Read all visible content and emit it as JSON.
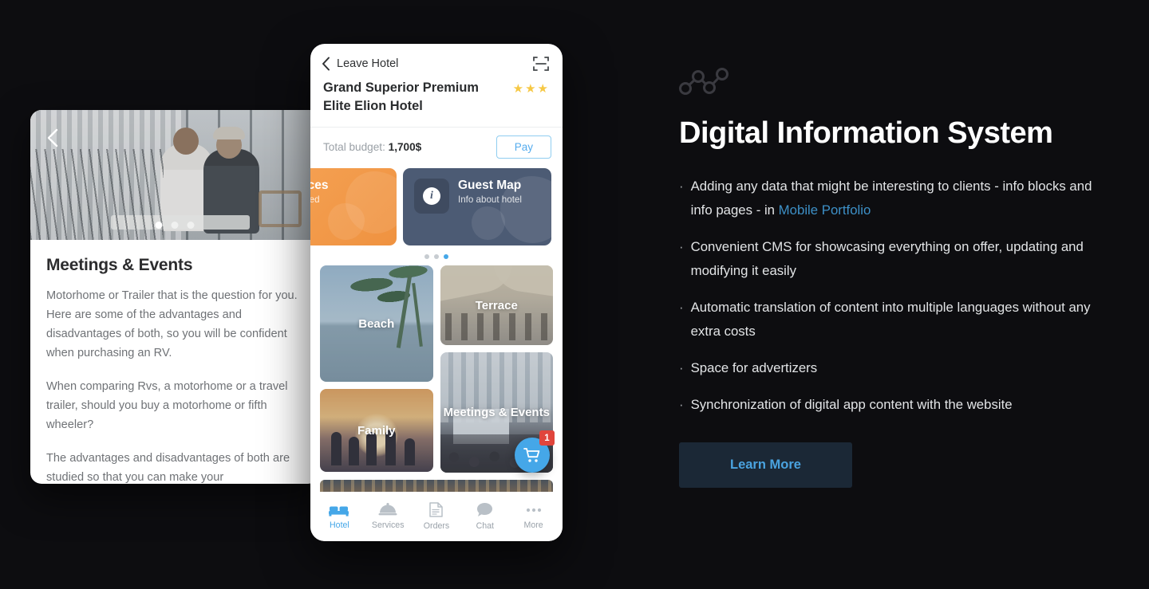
{
  "background_color": "#0d0d10",
  "left_card": {
    "back_icon": "chevron-left-icon",
    "carousel_dots": 3,
    "carousel_active_index": 0,
    "title": "Meetings & Events",
    "paragraphs": [
      "Motorhome or Trailer that is the question for you. Here are some of the advantages and disadvantages of both, so you will be confident when purchasing an RV.",
      "When comparing Rvs, a motorhome or a travel trailer, should you buy a motorhome or fifth wheeler?",
      "The advantages and disadvantages of both are studied so that you can make your"
    ]
  },
  "phone": {
    "topbar": {
      "back_label": "Leave Hotel",
      "back_icon": "chevron-left-icon",
      "scan_icon": "scan-frame-icon"
    },
    "hotel_name": "Grand Superior Premium Elite Elion Hotel",
    "stars": "★★★",
    "star_count": 3,
    "star_color": "#f6c844",
    "budget": {
      "label": "Total budget:",
      "value": "1,700$",
      "pay_label": "Pay",
      "pay_color": "#55acee"
    },
    "cards": [
      {
        "title": "ervices",
        "subtitle": "Ordered",
        "color": "#ef9240",
        "icon": null
      },
      {
        "title": "Guest Map",
        "subtitle": "Info about hotel",
        "color": "#4c5b74",
        "icon": "info-icon",
        "icon_glyph": "i"
      }
    ],
    "pager": {
      "count": 3,
      "active_index": 2,
      "active_color": "#45a7e8"
    },
    "tiles": [
      {
        "caption": "Beach"
      },
      {
        "caption": "Terrace"
      },
      {
        "caption": "Family"
      },
      {
        "caption": "Meetings & Events"
      }
    ],
    "fab": {
      "icon": "shopping-cart-icon",
      "badge": "1",
      "badge_color": "#e0453c",
      "color": "#45a7e8"
    },
    "tabs": [
      {
        "label": "Hotel",
        "icon": "bed-icon",
        "active": true
      },
      {
        "label": "Services",
        "icon": "room-service-icon",
        "active": false
      },
      {
        "label": "Orders",
        "icon": "document-icon",
        "active": false
      },
      {
        "label": "Chat",
        "icon": "chat-bubble-icon",
        "active": false
      },
      {
        "label": "More",
        "icon": "ellipsis-icon",
        "active": false
      }
    ]
  },
  "right_panel": {
    "icon": "line-chart-nodes-icon",
    "title": "Digital Information System",
    "bullets": [
      {
        "prefix": "Adding any data that might be interesting to clients - info blocks and info pages - in ",
        "link": "Mobile Portfolio",
        "suffix": ""
      },
      {
        "prefix": "Convenient CMS for showcasing everything on offer, updating and modifying it easily",
        "link": "",
        "suffix": ""
      },
      {
        "prefix": "Automatic translation of content into multiple languages without any extra costs",
        "link": "",
        "suffix": ""
      },
      {
        "prefix": "Space for advertizers",
        "link": "",
        "suffix": ""
      },
      {
        "prefix": "Synchronization of digital app content with the website",
        "link": "",
        "suffix": ""
      }
    ],
    "bullet_marker": "·",
    "link_color": "#3d90c7",
    "button": {
      "label": "Learn More",
      "bg": "#1b2836",
      "color": "#4aa3e0"
    }
  }
}
